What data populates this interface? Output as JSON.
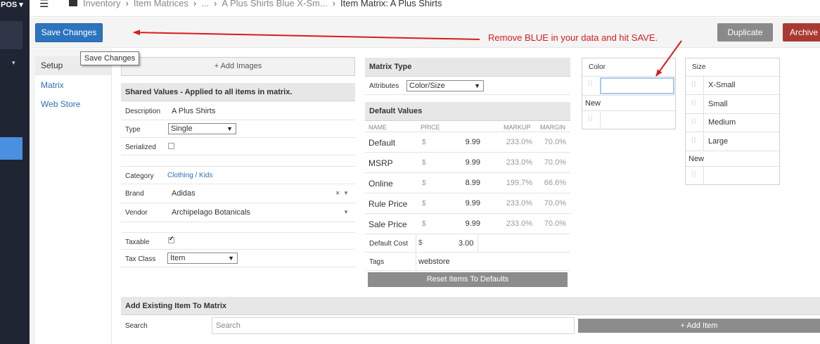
{
  "rail": {
    "pos_label": "POS ▾",
    "caret": "▾"
  },
  "header": {
    "menu_icon": "☰",
    "breadcrumbs": [
      "Inventory",
      "Item Matrices",
      "...",
      "A Plus Shirts Blue X-Sm...",
      "Item Matrix:  A Plus Shirts"
    ],
    "separator": "›"
  },
  "toolbar": {
    "save_label": "Save Changes",
    "duplicate_label": "Duplicate",
    "archive_label": "Archive",
    "annotation": "Remove BLUE in your data and hit SAVE.",
    "tooltip": "Save Changes"
  },
  "subnav": {
    "setup": "Setup",
    "matrix": "Matrix",
    "web_store": "Web Store"
  },
  "images": {
    "add_label": "+ Add Images"
  },
  "shared": {
    "title": "Shared Values - Applied to all items in matrix.",
    "description_label": "Description",
    "description_value": "A Plus Shirts",
    "type_label": "Type",
    "type_value": "Single",
    "serialized_label": "Serialized",
    "serialized": false,
    "category_label": "Category",
    "category_value": "Clothing / Kids",
    "brand_label": "Brand",
    "brand_value": "Adidas",
    "brand_clear": "×",
    "vendor_label": "Vendor",
    "vendor_value": "Archipelago Botanicals",
    "taxable_label": "Taxable",
    "taxable": true,
    "tax_class_label": "Tax Class",
    "tax_class_value": "Item"
  },
  "matrix_type": {
    "title": "Matrix Type",
    "attributes_label": "Attributes",
    "attributes_value": "Color/Size"
  },
  "defaults": {
    "title": "Default Values",
    "columns": {
      "name": "NAME",
      "price": "PRICE",
      "markup": "MARKUP",
      "margin": "MARGIN"
    },
    "currency": "$",
    "rows": [
      {
        "name": "Default",
        "price": "9.99",
        "markup": "233.0%",
        "margin": "70.0%"
      },
      {
        "name": "MSRP",
        "price": "9.99",
        "markup": "233.0%",
        "margin": "70.0%"
      },
      {
        "name": "Online",
        "price": "8.99",
        "markup": "199.7%",
        "margin": "66.6%"
      },
      {
        "name": "Rule Price",
        "price": "9.99",
        "markup": "233.0%",
        "margin": "70.0%"
      },
      {
        "name": "Sale Price",
        "price": "9.99",
        "markup": "233.0%",
        "margin": "70.0%"
      }
    ],
    "default_cost_label": "Default Cost",
    "default_cost_value": "3.00",
    "tags_label": "Tags",
    "tags_value": "webstore",
    "reset_label": "Reset Items To Defaults"
  },
  "color_attr": {
    "title": "Color",
    "values": [
      ""
    ],
    "new_label": "New"
  },
  "size_attr": {
    "title": "Size",
    "values": [
      "X-Small",
      "Small",
      "Medium",
      "Large"
    ],
    "new_label": "New"
  },
  "add_existing": {
    "title": "Add Existing Item To Matrix",
    "search_label": "Search",
    "search_placeholder": "Search",
    "add_label": "+ Add Item"
  },
  "colors": {
    "primary": "#2d74bf",
    "archive": "#a93a33",
    "annotation": "#d81c1c",
    "rail": "#1f2533"
  }
}
